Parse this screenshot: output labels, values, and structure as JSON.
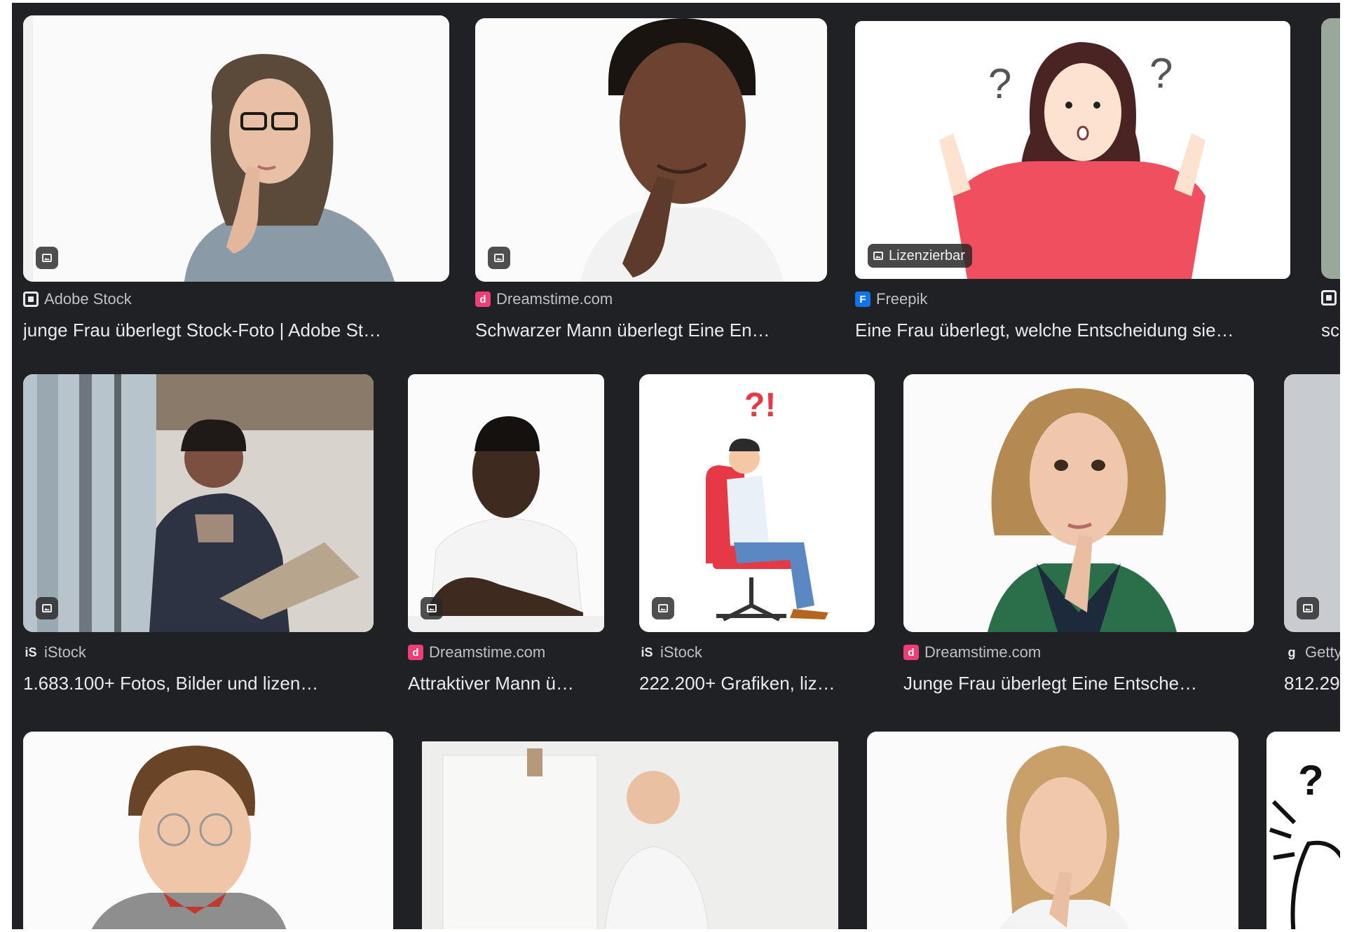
{
  "row1": [
    {
      "source": "Adobe Stock",
      "favicon": "adobe-stock-icon",
      "title": "junge Frau überlegt Stock-Foto | Adobe St…"
    },
    {
      "source": "Dreamstime.com",
      "favicon": "dreamstime-icon",
      "title": "Schwarzer Mann überlegt Eine En…"
    },
    {
      "source": "Freepik",
      "favicon": "freepik-icon",
      "title": "Eine Frau überlegt, welche Entscheidung sie…",
      "badge": "Lizenzierbar"
    },
    {
      "source": "",
      "favicon": "adobe-stock-icon",
      "title": "sc"
    }
  ],
  "row2": [
    {
      "source": "iStock",
      "favicon": "istock-icon",
      "title": "1.683.100+ Fotos, Bilder und lizen…"
    },
    {
      "source": "Dreamstime.com",
      "favicon": "dreamstime-icon",
      "title": "Attraktiver Mann ü…"
    },
    {
      "source": "iStock",
      "favicon": "istock-icon",
      "title": "222.200+ Grafiken, liz…"
    },
    {
      "source": "Dreamstime.com",
      "favicon": "dreamstime-icon",
      "title": "Junge Frau überlegt Eine Entsche…"
    },
    {
      "source": "Getty",
      "favicon": "getty-icon",
      "title": "812.29"
    }
  ],
  "glyphs": {
    "istock": "iS",
    "getty": "g",
    "freepik": "F",
    "dreamstime": "d",
    "question": "?!"
  },
  "colors": {
    "background": "#202124",
    "title": "#e8eaed",
    "source": "#bdc1c6",
    "dreamstime": "#ec3f73",
    "freepik": "#1273eb"
  }
}
